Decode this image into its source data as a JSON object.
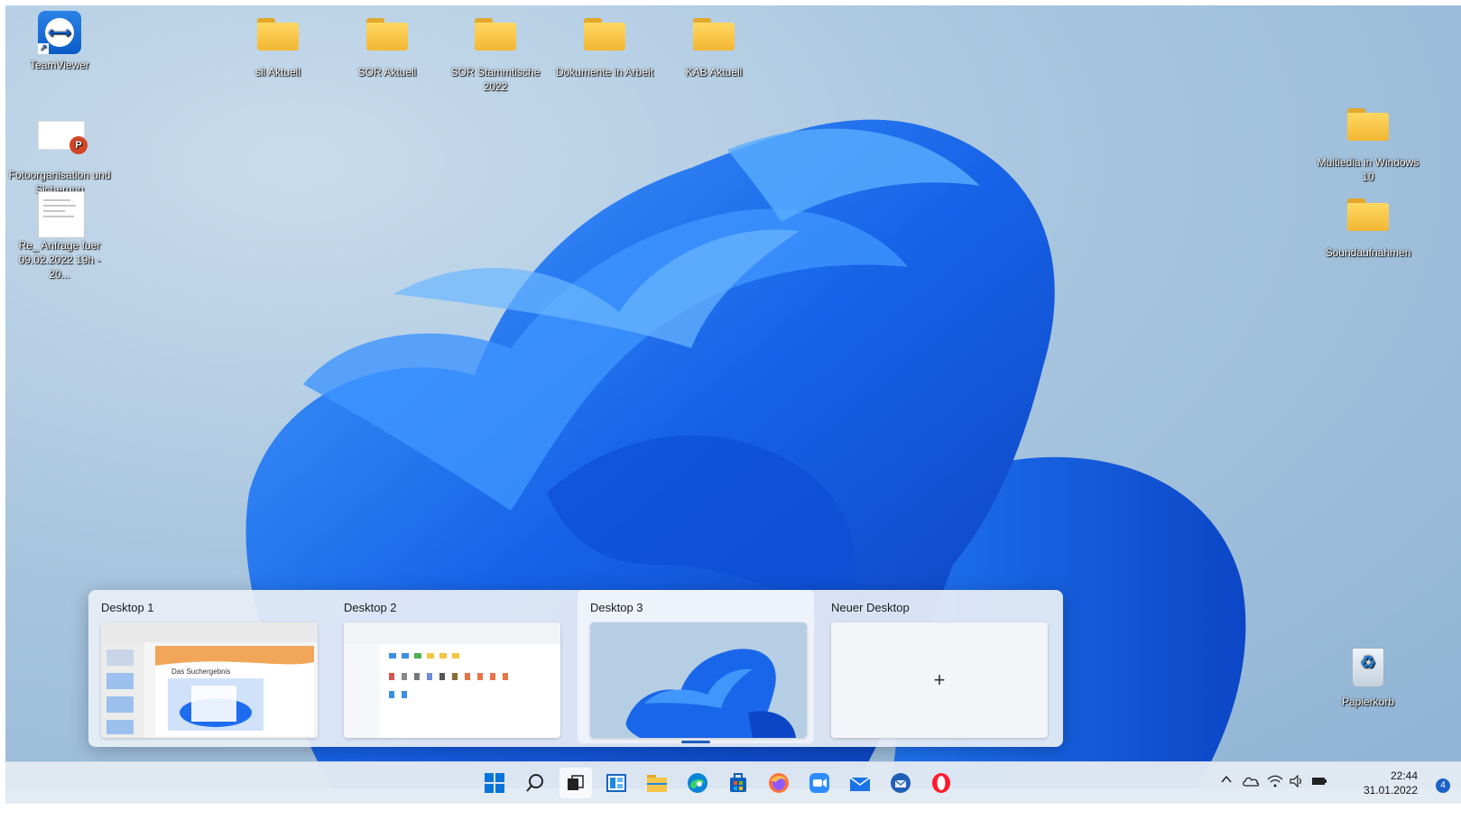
{
  "desktop_icons": {
    "teamviewer": "TeamViewer",
    "sil_aktuell": "sil Aktuell",
    "sor_aktuell": "SOR Aktuell",
    "sor_stammtische": "SOR Stammtische 2022",
    "dokumente": "Dokumente in Arbeit",
    "kab_aktuell": "KAB Aktuell",
    "fotoorganisation": "Fotoorganisation und Sicherung",
    "anfrage": "Re_ Anfrage fuer 09.02.2022 19h - 20...",
    "multimedia": "Multiedia in Windows 10",
    "soundaufnahmen": "Soundaufnahmen",
    "papierkorb": "Papierkorb"
  },
  "task_view": {
    "desktops": [
      {
        "label": "Desktop 1",
        "thumb_text": "Das Suchergebnis"
      },
      {
        "label": "Desktop 2"
      },
      {
        "label": "Desktop 3"
      },
      {
        "label": "Neuer Desktop",
        "plus": "+"
      }
    ]
  },
  "taskbar": {
    "apps": [
      "start-icon",
      "search-icon",
      "task-view-icon",
      "widgets-icon",
      "file-explorer-icon",
      "edge-icon",
      "store-icon",
      "firefox-icon",
      "zoom-icon",
      "mail-icon",
      "thunderbird-icon",
      "opera-icon"
    ],
    "tray": {
      "chevron": "^",
      "time": "22:44",
      "date": "31.01.2022",
      "notifications": "4"
    }
  },
  "colors": {
    "accent": "#1a62c8",
    "folder": "#f7c548",
    "wallpaper_bloom": "#1e6cf0"
  }
}
